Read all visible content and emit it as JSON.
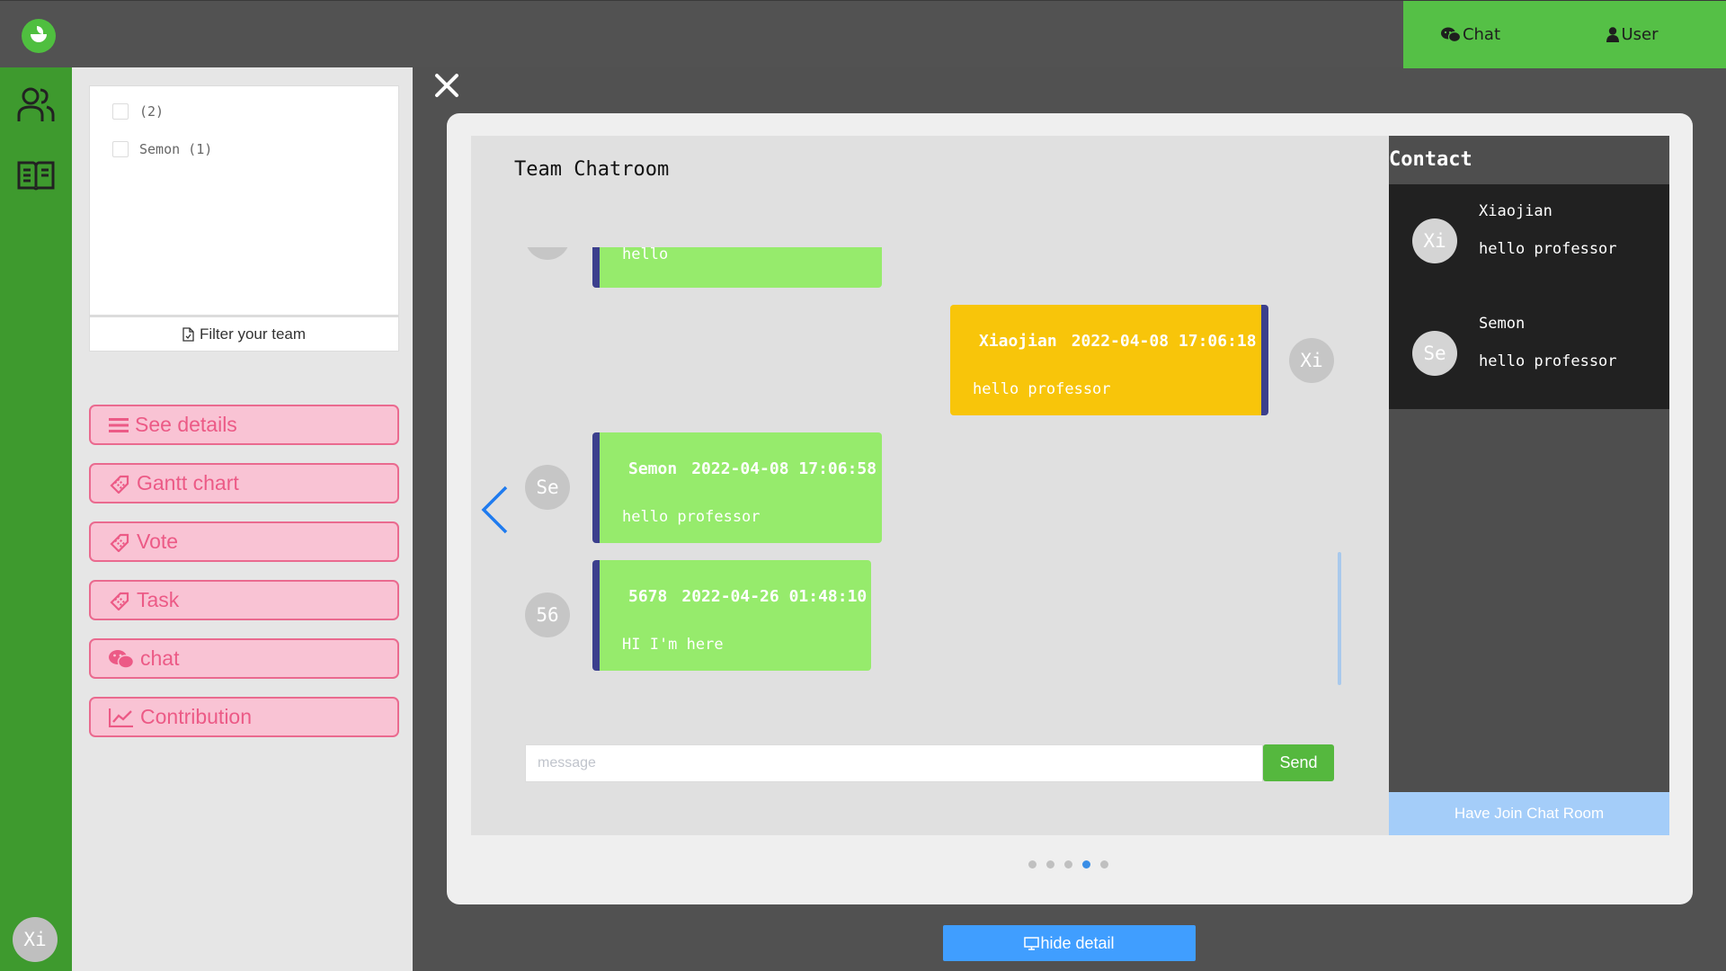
{
  "topnav": {
    "chat_label": "Chat",
    "user_label": "User"
  },
  "rail": {
    "avatar_text": "Xi"
  },
  "sidepanel": {
    "teams": [
      {
        "label": "(2)"
      },
      {
        "label": "Semon (1)"
      }
    ],
    "filter_label": "Filter your team",
    "menu": [
      {
        "label": "See details",
        "icon": "list-icon"
      },
      {
        "label": "Gantt chart",
        "icon": "ticket-icon"
      },
      {
        "label": "Vote",
        "icon": "ticket-icon"
      },
      {
        "label": "Task",
        "icon": "ticket-icon"
      },
      {
        "label": "chat",
        "icon": "wechat-icon"
      },
      {
        "label": "Contribution",
        "icon": "line-chart-icon"
      }
    ],
    "accent_color": "#ea6a8f"
  },
  "chat": {
    "title": "Team Chatroom",
    "messages": [
      {
        "avatar": "",
        "name": "",
        "time": "",
        "text": "hello"
      },
      {
        "avatar": "Xi",
        "name": "Xiaojian",
        "time": "2022-04-08 17:06:18",
        "text": "hello professor"
      },
      {
        "avatar": "Se",
        "name": "Semon",
        "time": "2022-04-08 17:06:58",
        "text": "hello professor"
      },
      {
        "avatar": "56",
        "name": "5678",
        "time": "2022-04-26 01:48:10",
        "text": "HI I'm here"
      }
    ],
    "input_placeholder": "message",
    "send_label": "Send"
  },
  "contacts": {
    "title": "Contact",
    "items": [
      {
        "avatar": "Xi",
        "name": "Xiaojian",
        "last_message": "hello professor"
      },
      {
        "avatar": "Se",
        "name": "Semon",
        "last_message": "hello professor"
      }
    ],
    "join_label": "Have Join Chat Room"
  },
  "carousel": {
    "count": 5,
    "active_index": 3
  },
  "hide_detail_label": "hide detail",
  "colors": {
    "brand_green": "#55c046",
    "rail_green": "#3e9a2e",
    "bubble_green": "#96eb6c",
    "bubble_mine": "#f8c50a",
    "primary_blue": "#409eff"
  }
}
